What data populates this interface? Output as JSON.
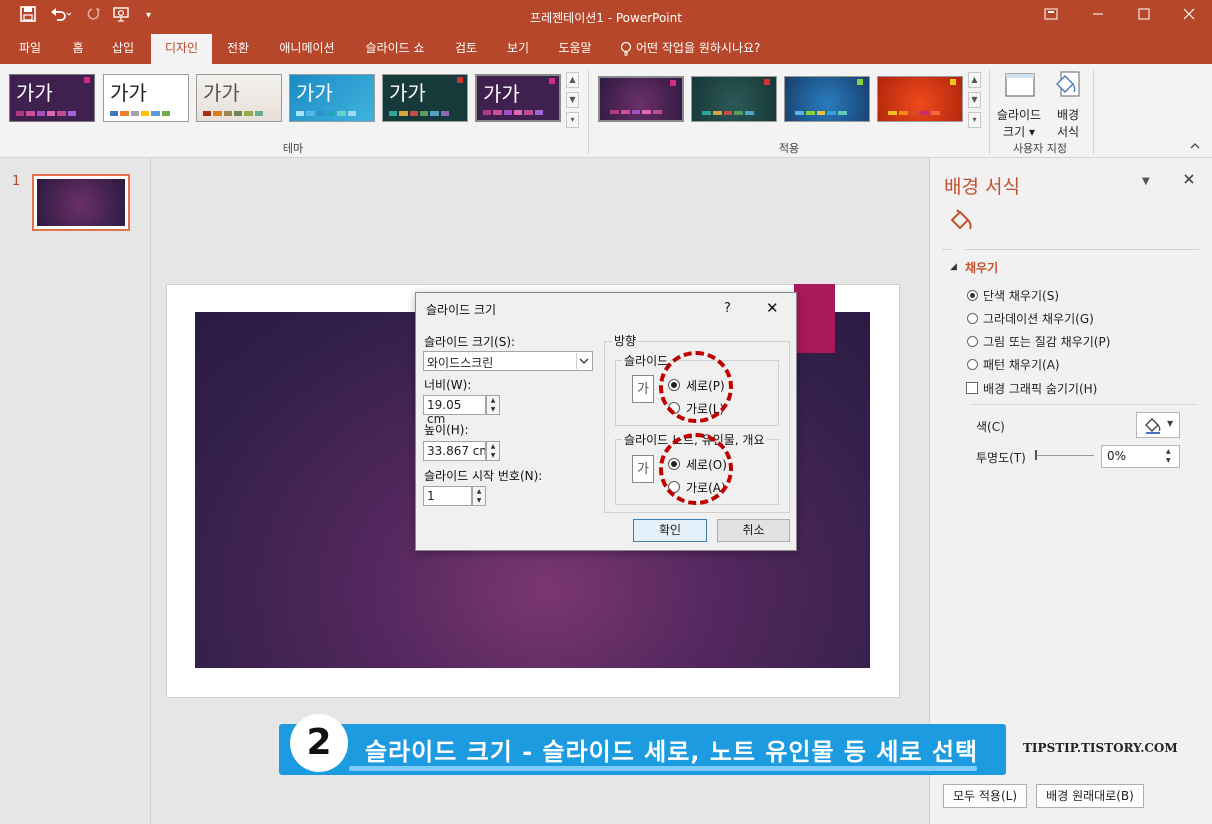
{
  "app": {
    "title": "프레젠테이션1  -  PowerPoint"
  },
  "qat": {
    "save_icon": "floppy-icon",
    "undo_icon": "undo-icon",
    "redo_icon": "redo-icon",
    "present_icon": "present-icon",
    "more_icon": "more-icon"
  },
  "tabs": [
    "파일",
    "홈",
    "삽입",
    "디자인",
    "전환",
    "애니메이션",
    "슬라이드 쇼",
    "검토",
    "보기",
    "도움말",
    "어떤 작업을 원하시나요?"
  ],
  "ribbon": {
    "theme_sample": "가가",
    "group_theme": "테마",
    "group_variant": "적용",
    "group_custom": "사용자 지정",
    "slide_size_label1": "슬라이드",
    "slide_size_label2": "크기",
    "bg_format_label1": "배경",
    "bg_format_label2": "서식"
  },
  "thumbnail": {
    "number": "1"
  },
  "dialog": {
    "title": "슬라이드 크기",
    "help": "?",
    "close": "✕",
    "size_label": "슬라이드 크기(S):",
    "size_value": "와이드스크린",
    "width_label": "너비(W):",
    "width_value": "19.05 cm",
    "height_label": "높이(H):",
    "height_value": "33.867 cm",
    "start_label": "슬라이드 시작 번호(N):",
    "start_value": "1",
    "orientation_label": "방향",
    "slides_group": "슬라이드",
    "notes_group": "슬라이드 노트, 유인물, 개요",
    "portrait": "세로(P)",
    "landscape": "가로(L)",
    "notes_portrait": "세로(O)",
    "notes_landscape": "가로(A)",
    "ga_char": "가",
    "ok": "확인",
    "cancel": "취소"
  },
  "format_pane": {
    "title": "배경 서식",
    "section": "채우기",
    "opt_solid": "단색 채우기(S)",
    "opt_gradient": "그라데이션 채우기(G)",
    "opt_picture": "그림 또는 질감 채우기(P)",
    "opt_pattern": "패턴 채우기(A)",
    "opt_hide": "배경 그래픽 숨기기(H)",
    "color_label": "색(C)",
    "transparency_label": "투명도(T)",
    "transparency_value": "0%",
    "apply_all": "모두 적용(L)",
    "reset": "배경 원래대로(B)"
  },
  "banner": {
    "number": "2",
    "text": "슬라이드 크기 - 슬라이드 세로, 노트 유인물 등 세로 선택"
  },
  "watermark": "TIPSTIP.TISTORY.COM",
  "colors": {
    "accent": "#b7472a",
    "banner": "#1d9be0",
    "highlight": "#c00000"
  }
}
